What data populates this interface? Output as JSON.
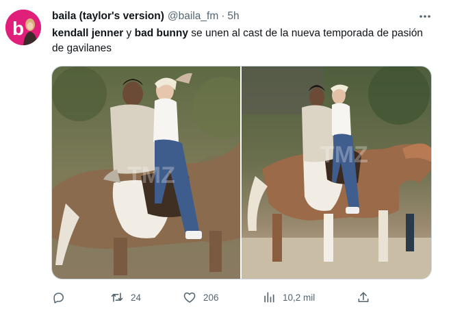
{
  "tweet": {
    "display_name": "baila (taylor's version)",
    "handle": "@baila_fm",
    "separator": "·",
    "time": "5h",
    "text": {
      "mention1": "kendall jenner",
      "connector": " y ",
      "mention2": "bad bunny",
      "rest": " se unen al cast de la nueva temporada de pasión de gavilanes"
    },
    "watermark_left": "TMZ",
    "watermark_right": "TMZ"
  },
  "actions": {
    "reply_count": "",
    "retweet_count": "24",
    "like_count": "206",
    "views_count": "10,2 mil"
  },
  "icons": {
    "more": "more-dots-icon",
    "reply": "reply-icon",
    "retweet": "retweet-icon",
    "like": "heart-icon",
    "views": "views-icon",
    "share": "share-icon"
  },
  "colors": {
    "avatar_bg": "#e01f7a",
    "text_secondary": "#536471",
    "text_primary": "#0f1419"
  }
}
